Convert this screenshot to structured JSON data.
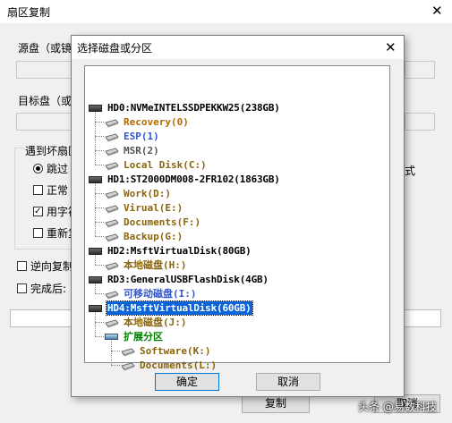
{
  "bg": {
    "title": "扇区复制",
    "source_label": "源盘（或镜",
    "target_label": "目标盘（或",
    "bad_sector_group": "遇到坏扇区",
    "skip_label": "跳过",
    "normal_label": "正常",
    "fill_label": "用字符",
    "retry_label": "重新复",
    "reverse_label": "逆向复制",
    "after_done_label": "完成后:",
    "side_label": "式",
    "copy_button": "复制",
    "cancel_button_partial": "取消"
  },
  "dialog": {
    "title": "选择磁盘或分区",
    "ok": "确定",
    "cancel": "取消",
    "tree": [
      {
        "level": 0,
        "label": "HD0:NVMeINTELSSDPEKKW25(238GB)",
        "color": "#000000",
        "icon": "disk"
      },
      {
        "level": 1,
        "label": "Recovery(0)",
        "color": "#b26a00",
        "icon": "partition"
      },
      {
        "level": 1,
        "label": "ESP(1)",
        "color": "#3355cc",
        "icon": "partition"
      },
      {
        "level": 1,
        "label": "MSR(2)",
        "color": "#555555",
        "icon": "partition"
      },
      {
        "level": 1,
        "label": "Local Disk(C:)",
        "color": "#8b6508",
        "icon": "partition"
      },
      {
        "level": 0,
        "label": "HD1:ST2000DM008-2FR102(1863GB)",
        "color": "#000000",
        "icon": "disk"
      },
      {
        "level": 1,
        "label": "Work(D:)",
        "color": "#8b6508",
        "icon": "partition"
      },
      {
        "level": 1,
        "label": "Virual(E:)",
        "color": "#8b6508",
        "icon": "partition"
      },
      {
        "level": 1,
        "label": "Documents(F:)",
        "color": "#8b6508",
        "icon": "partition"
      },
      {
        "level": 1,
        "label": "Backup(G:)",
        "color": "#8b6508",
        "icon": "partition"
      },
      {
        "level": 0,
        "label": "HD2:MsftVirtualDisk(80GB)",
        "color": "#000000",
        "icon": "disk"
      },
      {
        "level": 1,
        "label": "本地磁盘(H:)",
        "color": "#8b6508",
        "icon": "partition"
      },
      {
        "level": 0,
        "label": "RD3:GeneralUSBFlashDisk(4GB)",
        "color": "#000000",
        "icon": "disk"
      },
      {
        "level": 1,
        "label": "可移动磁盘(I:)",
        "color": "#3355cc",
        "icon": "partition"
      },
      {
        "level": 0,
        "label": "HD4:MsftVirtualDisk(60GB)",
        "color": "#000000",
        "icon": "disk",
        "selected": true
      },
      {
        "level": 1,
        "label": "本地磁盘(J:)",
        "color": "#8b6508",
        "icon": "partition"
      },
      {
        "level": 1,
        "label": "扩展分区",
        "color": "#008000",
        "icon": "extended"
      },
      {
        "level": 2,
        "label": "Software(K:)",
        "color": "#8b6508",
        "icon": "partition"
      },
      {
        "level": 2,
        "label": "Documents(L:)",
        "color": "#8b6508",
        "icon": "partition"
      }
    ]
  },
  "watermark": "头条 @易数科技"
}
